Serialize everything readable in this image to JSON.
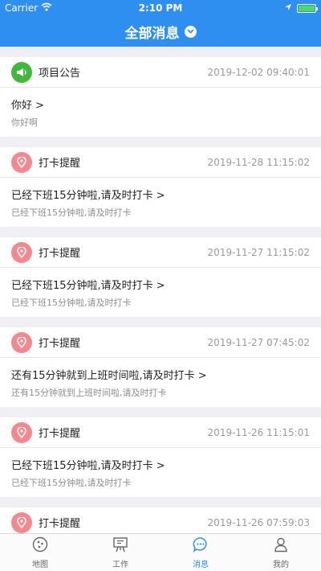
{
  "status_bar": {
    "carrier": "Carrier",
    "time": "2:10 PM"
  },
  "nav": {
    "title": "全部消息"
  },
  "messages": [
    {
      "type": "项目公告",
      "icon": "megaphone-icon",
      "color": "green",
      "time": "2019-12-02 09:40:01",
      "title": "你好 >",
      "body": "你好啊"
    },
    {
      "type": "打卡提醒",
      "icon": "location-pin-icon",
      "color": "pink",
      "time": "2019-11-28 11:15:02",
      "title": "已经下班15分钟啦,请及时打卡 >",
      "body": "已经下班15分钟啦,请及时打卡"
    },
    {
      "type": "打卡提醒",
      "icon": "location-pin-icon",
      "color": "pink",
      "time": "2019-11-27 11:15:02",
      "title": "已经下班15分钟啦,请及时打卡 >",
      "body": "已经下班15分钟啦,请及时打卡"
    },
    {
      "type": "打卡提醒",
      "icon": "location-pin-icon",
      "color": "pink",
      "time": "2019-11-27 07:45:02",
      "title": "还有15分钟就到上班时间啦,请及时打卡 >",
      "body": "还有15分钟就到上班时间啦,请及时打卡"
    },
    {
      "type": "打卡提醒",
      "icon": "location-pin-icon",
      "color": "pink",
      "time": "2019-11-26 11:15:01",
      "title": "已经下班15分钟啦,请及时打卡 >",
      "body": "已经下班15分钟啦,请及时打卡"
    },
    {
      "type": "打卡提醒",
      "icon": "location-pin-icon",
      "color": "pink",
      "time": "2019-11-26 07:59:03",
      "title": "",
      "body": ""
    }
  ],
  "tabs": [
    {
      "label": "地图",
      "icon": "map-icon",
      "active": false
    },
    {
      "label": "工作",
      "icon": "easel-icon",
      "active": false
    },
    {
      "label": "消息",
      "icon": "chat-bubble-icon",
      "active": true
    },
    {
      "label": "我的",
      "icon": "user-icon",
      "active": false
    }
  ],
  "colors": {
    "primary": "#2f8ff0",
    "announcement": "#3fb93a",
    "reminder": "#f5878e"
  }
}
